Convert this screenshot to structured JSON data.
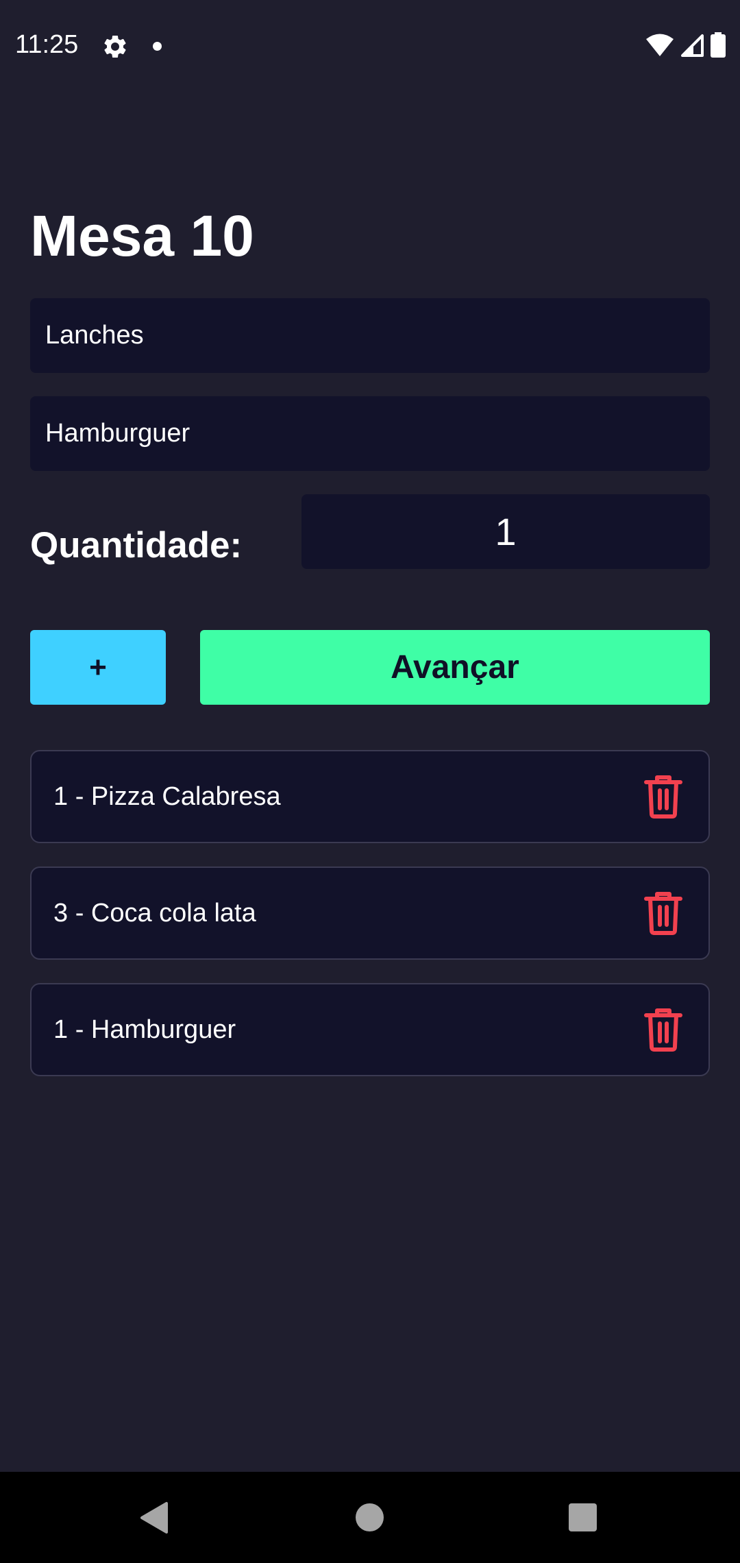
{
  "status_bar": {
    "time": "11:25",
    "icons": [
      "gear-icon",
      "notification-dot-icon",
      "wifi-icon",
      "cell-signal-icon",
      "battery-icon"
    ]
  },
  "page": {
    "title": "Mesa 10"
  },
  "form": {
    "category_value": "Lanches",
    "product_value": "Hamburguer",
    "quantity_label": "Quantidade:",
    "quantity_value": "1"
  },
  "actions": {
    "add_label": "+",
    "next_label": "Avançar"
  },
  "order_items": [
    {
      "text": "1 - Pizza Calabresa",
      "icon": "trash-icon"
    },
    {
      "text": "3 - Coca cola lata",
      "icon": "trash-icon"
    },
    {
      "text": "1 - Hamburguer",
      "icon": "trash-icon"
    }
  ],
  "nav_bar": {
    "icons": [
      "back-icon",
      "home-icon",
      "recents-icon"
    ]
  },
  "colors": {
    "background": "#1f1e2e",
    "field_background": "#12122a",
    "add_button": "#3fd0ff",
    "next_button": "#3ffea6",
    "delete_icon": "#f2414f",
    "nav_background": "#000000"
  }
}
